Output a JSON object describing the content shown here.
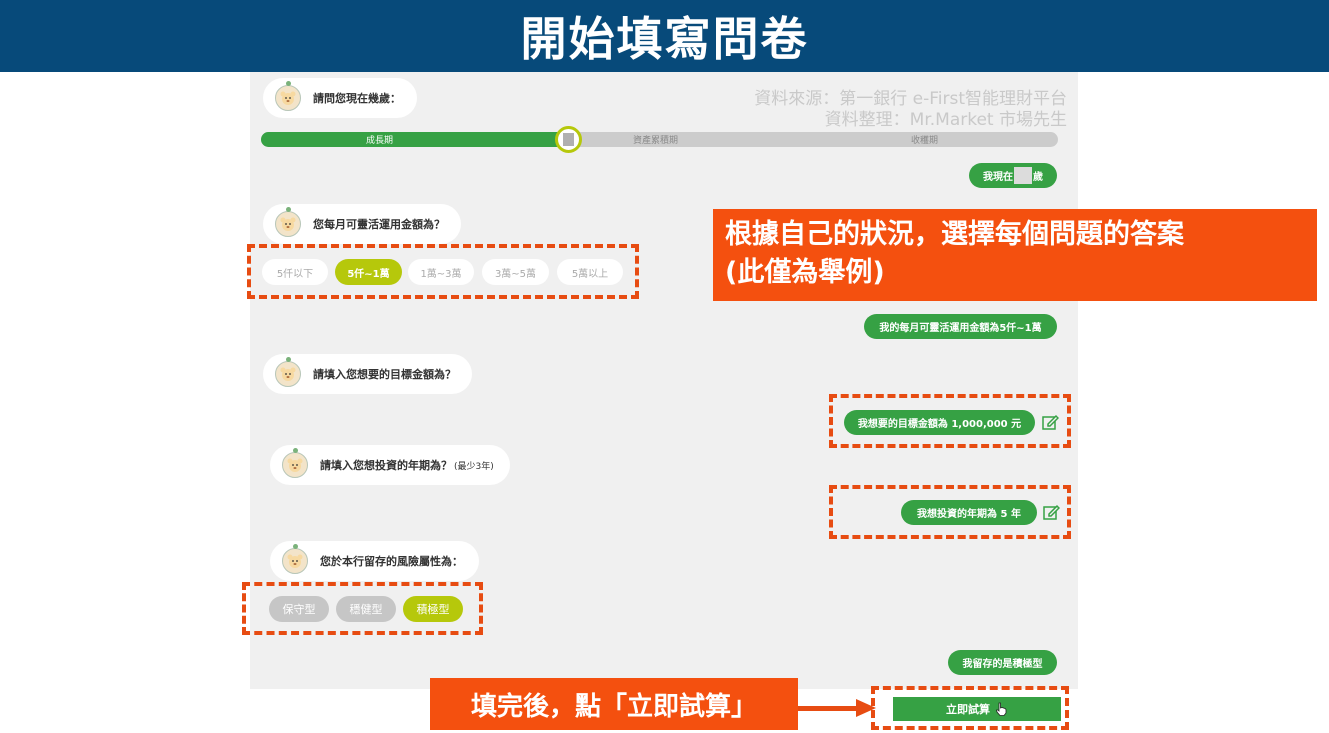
{
  "header": {
    "title": "開始填寫問卷"
  },
  "source": {
    "line1": "資料來源：第一銀行 e-First智能理財平台",
    "line2": "資料整理：Mr.Market 市場先生"
  },
  "progress": {
    "fill": 0.385,
    "stages": [
      "成長期",
      "資產累積期",
      "收穫期"
    ]
  },
  "questions": {
    "age": "請問您現在幾歲：",
    "monthly": "您每月可靈活運用金額為？",
    "target": "請填入您想要的目標金額為？",
    "years": "請填入您想投資的年期為？",
    "years_hint": "(最少3年)",
    "risk": "您於本行留存的風險屬性為："
  },
  "answers": {
    "age_prefix": "我現在",
    "age_suffix": "歲",
    "monthly": "我的每月可靈活運用金額為5仟~1萬",
    "target": "我想要的目標金額為 1,000,000 元",
    "years": "我想投資的年期為 5 年",
    "risk": "我留存的是積極型"
  },
  "monthly_options": [
    {
      "label": "5仟以下",
      "selected": false
    },
    {
      "label": "5仟~1萬",
      "selected": true
    },
    {
      "label": "1萬~3萬",
      "selected": false
    },
    {
      "label": "3萬~5萬",
      "selected": false
    },
    {
      "label": "5萬以上",
      "selected": false
    }
  ],
  "risk_options": [
    {
      "label": "保守型",
      "selected": false
    },
    {
      "label": "穩健型",
      "selected": false
    },
    {
      "label": "積極型",
      "selected": true
    }
  ],
  "callouts": {
    "main_line1": "根據自己的狀況，選擇每個問題的答案",
    "main_line2": "(此僅為舉例)",
    "bottom": "填完後，點「立即試算」"
  },
  "calc_button": {
    "label": "立即試算"
  },
  "colors": {
    "header": "#074a7a",
    "green": "#36a144",
    "lime": "#b6c80b",
    "orange": "#f4500f",
    "dash": "#e74c12"
  }
}
